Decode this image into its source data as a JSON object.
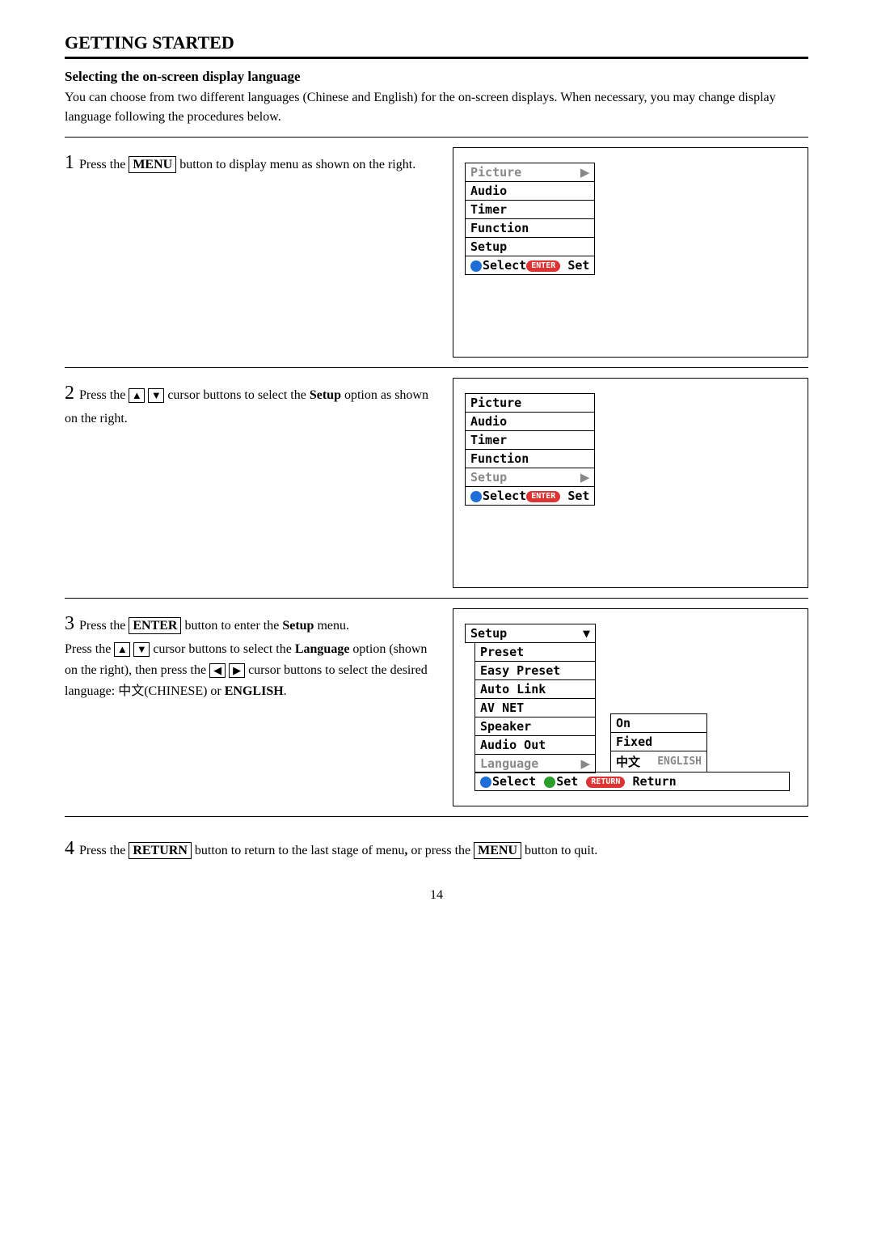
{
  "title": "GETTING STARTED",
  "sub": "Selecting the on-screen display language",
  "intro": "You can choose from two different languages (Chinese and English) for the on-screen displays. When necessary, you may change display language following the procedures below.",
  "s1": {
    "a": "Press the",
    "b": "MENU",
    "c": "button to display menu as shown on the right."
  },
  "s2": {
    "a": "Press the",
    "b": "cursor buttons to select the",
    "c": "Setup",
    "d": "option as shown on the right."
  },
  "s3": {
    "a": "Press the",
    "b": "ENTER",
    "c": "button to enter the",
    "d": "Setup",
    "e": "menu.",
    "f": "Press the",
    "g": "cursor buttons to select the",
    "h": "Language",
    "i": "option (shown on the right), then press the",
    "j": "cursor buttons to select the desired language:",
    "k": "中文(CHINESE) or",
    "l": "ENGLISH",
    "m": "."
  },
  "s4": {
    "a": "Press the",
    "b": "RETURN",
    "c": "button to return to the last stage of menu",
    "d": ",",
    "e": "or press the",
    "f": "MENU",
    "g": "button to quit."
  },
  "menu": {
    "picture": "Picture",
    "audio": "Audio",
    "timer": "Timer",
    "function": "Function",
    "setup": "Setup",
    "select": "Select",
    "enter": "ENTER",
    "set": "Set"
  },
  "setup": {
    "title": "Setup",
    "preset": "Preset",
    "easy": "Easy Preset",
    "auto": "Auto Link",
    "av": "AV NET",
    "speaker": "Speaker",
    "audioout": "Audio Out",
    "language": "Language",
    "on": "On",
    "fixed": "Fixed",
    "chinese": "中文",
    "english": "ENGLISH",
    "select": "Select",
    "setbtn": "Set",
    "returnpill": "RETURN",
    "return": "Return"
  },
  "arrows": {
    "up": "▲",
    "down": "▼",
    "left": "◀",
    "right": "▶"
  },
  "pageNum": "14"
}
